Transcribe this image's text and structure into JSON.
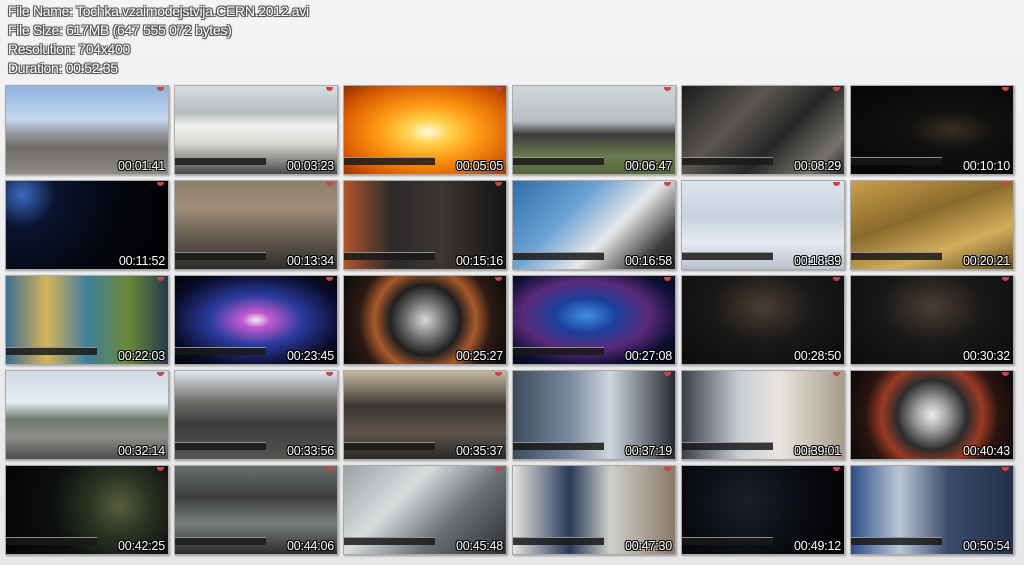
{
  "header": {
    "file_name": "File Name: Tochka.vzaimodejstvija.CERN.2012.avi",
    "file_size": "File Size: 617MB (647 555 072 bytes)",
    "resolution": "Resolution: 704x400",
    "duration": "Duration: 00:52:35"
  },
  "thumbnails": [
    {
      "time": "00:01:41",
      "bg": "linear-gradient(180deg,#8fb3e0 0%,#c6d8ee 38%,#9aa0a6 52%,#6f6b66 70%,#8e8a84 100%)",
      "caption": false
    },
    {
      "time": "00:03:23",
      "bg": "linear-gradient(180deg,#d7dde3 0%,#b7bcbe 30%,#f2f2f0 45%,#d9d9d6 65%,#4a4a48 100%)",
      "caption": true
    },
    {
      "time": "00:05:05",
      "bg": "radial-gradient(ellipse at 52% 52%,#fffbe0 0%,#ffd24d 18%,#ff9a14 42%,#d85a00 75%,#8a3000 100%)",
      "caption": true
    },
    {
      "time": "00:06:47",
      "bg": "linear-gradient(180deg,#cfd6da 0%,#b8bfc2 40%,#3e3b3a 55%,#6a7a4c 80%,#55673b 100%)",
      "caption": true
    },
    {
      "time": "00:08:29",
      "bg": "linear-gradient(135deg,#1b1b1b 0%,#5a5651 35%,#262626 60%,#77746d 85%,#2a2a2a 100%)",
      "caption": true
    },
    {
      "time": "00:10:10",
      "bg": "radial-gradient(ellipse at 62% 50%,#3a2e22 0%,#111 30%,#050505 100%)",
      "caption": true
    },
    {
      "time": "00:11:52",
      "bg": "radial-gradient(circle at 10% 15%,#3a6ac0 0%,#0b1430 20%,#03050b 60%,#010203 100%)",
      "caption": false
    },
    {
      "time": "00:13:34",
      "bg": "linear-gradient(180deg,#8b7e6b 0%,#a08f78 30%,#6c6155 60%,#2e2c2a 100%)",
      "caption": true
    },
    {
      "time": "00:15:16",
      "bg": "linear-gradient(90deg,#b0562b 0%,#2a2a2a 30%,#3d3631 60%,#141414 100%)",
      "caption": true
    },
    {
      "time": "00:16:58",
      "bg": "linear-gradient(135deg,#2e6fa8 0%,#6aa3d4 35%,#e8e8ea 60%,#3a3a3a 85%,#222 100%)",
      "caption": true
    },
    {
      "time": "00:18:39",
      "bg": "linear-gradient(180deg,#dde4ee 0%,#c8d2de 40%,#e5eaf0 70%,#b9c2cc 100%)",
      "caption": true
    },
    {
      "time": "00:20:21",
      "bg": "linear-gradient(160deg,#c9a04a 0%,#8a6a2c 40%,#d2ae5c 70%,#5e4920 100%)",
      "caption": true
    },
    {
      "time": "00:22:03",
      "bg": "linear-gradient(90deg,#3b6e8e 0%,#d7b45a 25%,#3e7f9c 50%,#6a8a38 75%,#263b4e 100%)",
      "caption": true
    },
    {
      "time": "00:23:45",
      "bg": "radial-gradient(ellipse at 50% 50%,#f3f3f3 0%,#c25bd1 12%,#2a3b9e 40%,#0a0d2a 75%,#020308 100%)",
      "caption": true
    },
    {
      "time": "00:25:27",
      "bg": "radial-gradient(circle at 50% 50%,#d9d9d9 0%,#6a6a6a 22%,#1f1f1f 38%,#a85a2a 55%,#2a1a12 72%,#0b0b0b 100%)",
      "caption": false
    },
    {
      "time": "00:27:08",
      "bg": "radial-gradient(ellipse at 45% 45%,#3f8fe6 0%,#1b3f9a 25%,#5a2a7a 50%,#0a0f30 75%,#020410 100%)",
      "caption": true
    },
    {
      "time": "00:28:50",
      "bg": "radial-gradient(ellipse at 50% 35%,#4a3e32 0%,#181818 45%,#0c0c0c 100%)",
      "caption": false
    },
    {
      "time": "00:30:32",
      "bg": "radial-gradient(ellipse at 50% 35%,#4a3e32 0%,#181818 45%,#0c0c0c 100%)",
      "caption": false
    },
    {
      "time": "00:32:14",
      "bg": "linear-gradient(180deg,#cfd9e6 0%,#e6edf3 35%,#6d7a6a 55%,#8d8d8a 75%,#4c4c4a 100%)",
      "caption": false
    },
    {
      "time": "00:33:56",
      "bg": "linear-gradient(180deg,#e3e8ec 0%,#6d6e6a 35%,#3c3c3e 60%,#565350 100%)",
      "caption": true
    },
    {
      "time": "00:35:37",
      "bg": "linear-gradient(180deg,#c6b89c 0%,#3b3733 40%,#5d554d 70%,#2b2926 100%)",
      "caption": true
    },
    {
      "time": "00:37:19",
      "bg": "linear-gradient(90deg,#3a4b5a 0%,#7a8aa0 35%,#cfd6de 60%,#252a30 100%)",
      "caption": true
    },
    {
      "time": "00:39:01",
      "bg": "linear-gradient(90deg,#3a3d45 0%,#c8ccd2 35%,#e9e6de 60%,#a69c8c 100%)",
      "caption": true
    },
    {
      "time": "00:40:43",
      "bg": "radial-gradient(circle at 50% 50%,#efefef 0%,#9c9c9c 18%,#2c2c2c 38%,#9a3a24 55%,#2b1410 72%,#090909 100%)",
      "caption": false
    },
    {
      "time": "00:42:25",
      "bg": "radial-gradient(circle at 70% 45%,#5a5e3c 0%,#2a3322 25%,#0c0e10 55%,#030404 100%)",
      "caption": true
    },
    {
      "time": "00:44:06",
      "bg": "linear-gradient(180deg,#6b6f6e 0%,#3a3d3c 35%,#7a7e7c 65%,#2a2d2c 100%)",
      "caption": true
    },
    {
      "time": "00:45:48",
      "bg": "linear-gradient(135deg,#9aa3a6 0%,#d8dcdd 35%,#6a7074 65%,#2d3033 100%)",
      "caption": true
    },
    {
      "time": "00:47:30",
      "bg": "linear-gradient(90deg,#e5e4e0 0%,#2a3a5a 35%,#cfcfcb 60%,#8a7a66 100%)",
      "caption": true
    },
    {
      "time": "00:49:12",
      "bg": "radial-gradient(circle at 40% 40%,#1a1f2a 0%,#07090d 60%,#020203 100%)",
      "caption": true
    },
    {
      "time": "00:50:54",
      "bg": "linear-gradient(90deg,#2d4e86 0%,#b9c6d6 30%,#3a4a6a 60%,#22304a 100%)",
      "caption": true
    }
  ]
}
